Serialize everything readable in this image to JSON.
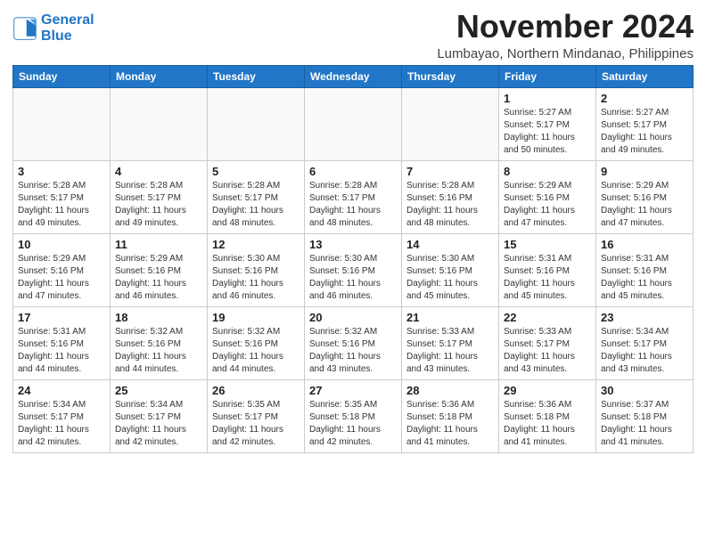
{
  "logo": {
    "line1": "General",
    "line2": "Blue"
  },
  "title": "November 2024",
  "location": "Lumbayao, Northern Mindanao, Philippines",
  "weekdays": [
    "Sunday",
    "Monday",
    "Tuesday",
    "Wednesday",
    "Thursday",
    "Friday",
    "Saturday"
  ],
  "weeks": [
    [
      {
        "day": "",
        "info": ""
      },
      {
        "day": "",
        "info": ""
      },
      {
        "day": "",
        "info": ""
      },
      {
        "day": "",
        "info": ""
      },
      {
        "day": "",
        "info": ""
      },
      {
        "day": "1",
        "info": "Sunrise: 5:27 AM\nSunset: 5:17 PM\nDaylight: 11 hours\nand 50 minutes."
      },
      {
        "day": "2",
        "info": "Sunrise: 5:27 AM\nSunset: 5:17 PM\nDaylight: 11 hours\nand 49 minutes."
      }
    ],
    [
      {
        "day": "3",
        "info": "Sunrise: 5:28 AM\nSunset: 5:17 PM\nDaylight: 11 hours\nand 49 minutes."
      },
      {
        "day": "4",
        "info": "Sunrise: 5:28 AM\nSunset: 5:17 PM\nDaylight: 11 hours\nand 49 minutes."
      },
      {
        "day": "5",
        "info": "Sunrise: 5:28 AM\nSunset: 5:17 PM\nDaylight: 11 hours\nand 48 minutes."
      },
      {
        "day": "6",
        "info": "Sunrise: 5:28 AM\nSunset: 5:17 PM\nDaylight: 11 hours\nand 48 minutes."
      },
      {
        "day": "7",
        "info": "Sunrise: 5:28 AM\nSunset: 5:16 PM\nDaylight: 11 hours\nand 48 minutes."
      },
      {
        "day": "8",
        "info": "Sunrise: 5:29 AM\nSunset: 5:16 PM\nDaylight: 11 hours\nand 47 minutes."
      },
      {
        "day": "9",
        "info": "Sunrise: 5:29 AM\nSunset: 5:16 PM\nDaylight: 11 hours\nand 47 minutes."
      }
    ],
    [
      {
        "day": "10",
        "info": "Sunrise: 5:29 AM\nSunset: 5:16 PM\nDaylight: 11 hours\nand 47 minutes."
      },
      {
        "day": "11",
        "info": "Sunrise: 5:29 AM\nSunset: 5:16 PM\nDaylight: 11 hours\nand 46 minutes."
      },
      {
        "day": "12",
        "info": "Sunrise: 5:30 AM\nSunset: 5:16 PM\nDaylight: 11 hours\nand 46 minutes."
      },
      {
        "day": "13",
        "info": "Sunrise: 5:30 AM\nSunset: 5:16 PM\nDaylight: 11 hours\nand 46 minutes."
      },
      {
        "day": "14",
        "info": "Sunrise: 5:30 AM\nSunset: 5:16 PM\nDaylight: 11 hours\nand 45 minutes."
      },
      {
        "day": "15",
        "info": "Sunrise: 5:31 AM\nSunset: 5:16 PM\nDaylight: 11 hours\nand 45 minutes."
      },
      {
        "day": "16",
        "info": "Sunrise: 5:31 AM\nSunset: 5:16 PM\nDaylight: 11 hours\nand 45 minutes."
      }
    ],
    [
      {
        "day": "17",
        "info": "Sunrise: 5:31 AM\nSunset: 5:16 PM\nDaylight: 11 hours\nand 44 minutes."
      },
      {
        "day": "18",
        "info": "Sunrise: 5:32 AM\nSunset: 5:16 PM\nDaylight: 11 hours\nand 44 minutes."
      },
      {
        "day": "19",
        "info": "Sunrise: 5:32 AM\nSunset: 5:16 PM\nDaylight: 11 hours\nand 44 minutes."
      },
      {
        "day": "20",
        "info": "Sunrise: 5:32 AM\nSunset: 5:16 PM\nDaylight: 11 hours\nand 43 minutes."
      },
      {
        "day": "21",
        "info": "Sunrise: 5:33 AM\nSunset: 5:17 PM\nDaylight: 11 hours\nand 43 minutes."
      },
      {
        "day": "22",
        "info": "Sunrise: 5:33 AM\nSunset: 5:17 PM\nDaylight: 11 hours\nand 43 minutes."
      },
      {
        "day": "23",
        "info": "Sunrise: 5:34 AM\nSunset: 5:17 PM\nDaylight: 11 hours\nand 43 minutes."
      }
    ],
    [
      {
        "day": "24",
        "info": "Sunrise: 5:34 AM\nSunset: 5:17 PM\nDaylight: 11 hours\nand 42 minutes."
      },
      {
        "day": "25",
        "info": "Sunrise: 5:34 AM\nSunset: 5:17 PM\nDaylight: 11 hours\nand 42 minutes."
      },
      {
        "day": "26",
        "info": "Sunrise: 5:35 AM\nSunset: 5:17 PM\nDaylight: 11 hours\nand 42 minutes."
      },
      {
        "day": "27",
        "info": "Sunrise: 5:35 AM\nSunset: 5:18 PM\nDaylight: 11 hours\nand 42 minutes."
      },
      {
        "day": "28",
        "info": "Sunrise: 5:36 AM\nSunset: 5:18 PM\nDaylight: 11 hours\nand 41 minutes."
      },
      {
        "day": "29",
        "info": "Sunrise: 5:36 AM\nSunset: 5:18 PM\nDaylight: 11 hours\nand 41 minutes."
      },
      {
        "day": "30",
        "info": "Sunrise: 5:37 AM\nSunset: 5:18 PM\nDaylight: 11 hours\nand 41 minutes."
      }
    ]
  ]
}
